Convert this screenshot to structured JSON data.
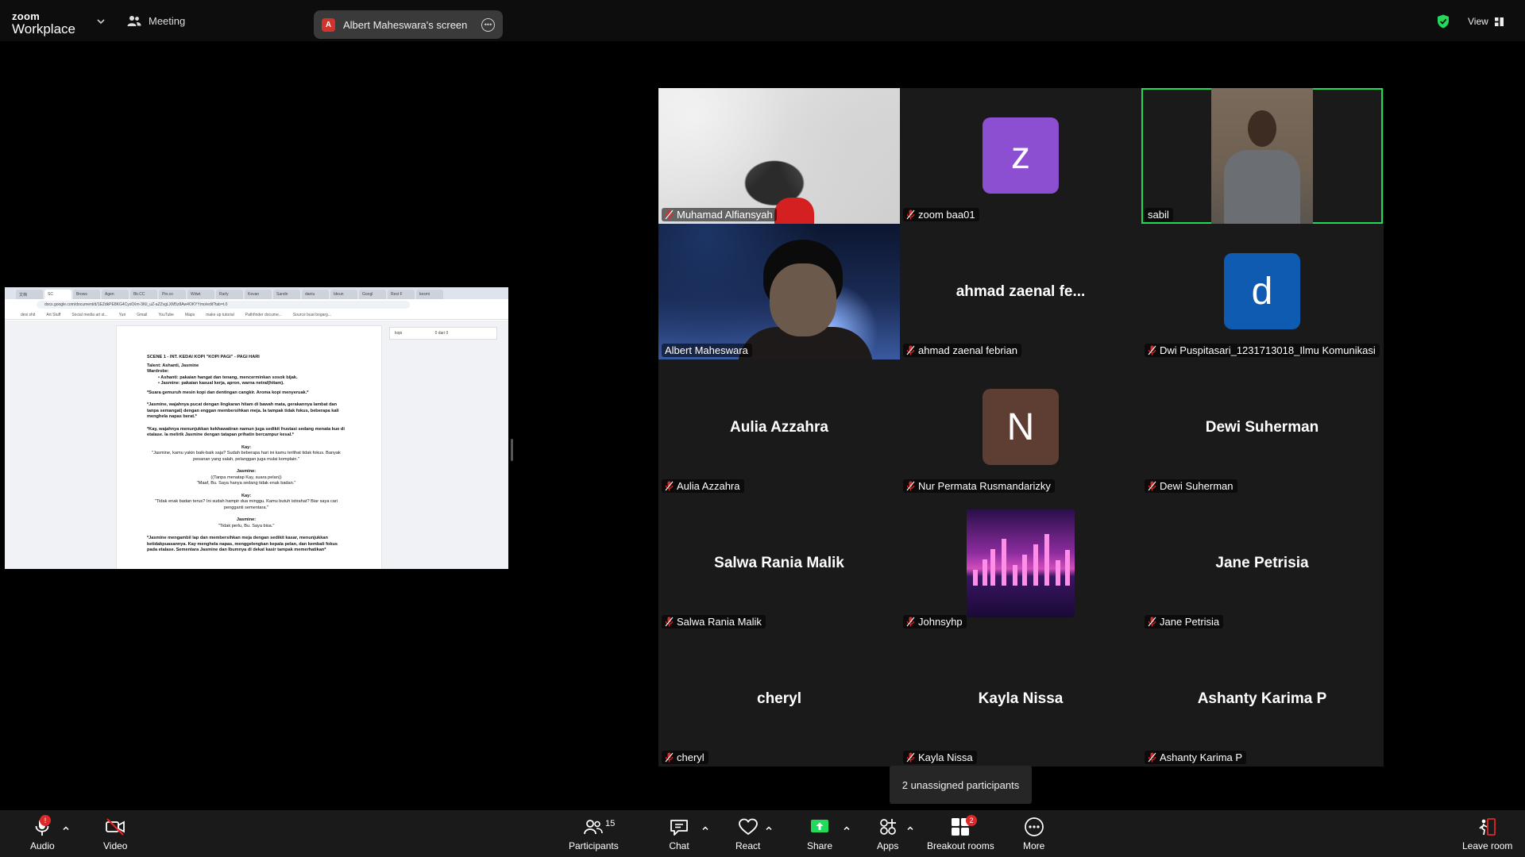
{
  "topbar": {
    "logo_line1": "zoom",
    "logo_line2": "Workplace",
    "meeting_label": "Meeting",
    "sharing_label": "Albert Maheswara's screen",
    "sharing_avatar_letter": "A",
    "view_label": "View",
    "security_color": "#23d959"
  },
  "shared_screen": {
    "tabs": [
      "文档",
      "SC",
      "Brows",
      "Agen",
      "Bk.CC",
      "Pin.co",
      "Wdwt",
      "Rarly",
      "Kevan",
      "Sandn",
      "daniu",
      "Ideun",
      "Googl",
      "Rest F",
      "kesmi"
    ],
    "url": "docs.google.com/document/d/1EZdkPE8KG4Cyx0Xm-3Kil_uZ-aZZvgLXM5z8Aw4OKYYmo/edit?tab=t.0",
    "bookmarks": [
      "desi shit",
      "Art Stuff",
      "Social media art st...",
      "Yuri",
      "Gmail",
      "YouTube",
      "Maps",
      "make up tutorial",
      "Pathfinder docume...",
      "Source buat bogarg..."
    ],
    "find_text": "kopi",
    "find_count": "0 dari 0",
    "doc": {
      "heading": "SCENE 1 - INT. KEDAI KOPI \"KOPI PAGI\" - PAGI HARI",
      "talent": "Talent: Ashanti, Jasmine",
      "wardrobe": "Wardrobe:",
      "w1": "•  Ashanti: pakaian hangat dan tenang, mencerminkan sosok bijak.",
      "w2": "•  Jasmine: pakaian kasual kerja, apron, warna netral(hitam).",
      "p1": "*Suara gemuruh mesin kopi dan dentingan cangkir. Aroma kopi menyeruak.*",
      "p2": "*Jasmine, wajahnya pucat dengan lingkaran hitam di bawah mata, gerakannya lambat dan tanpa semangat) dengan enggan membersihkan meja. Ia tampak tidak fokus, beberapa kali menghela napas berat.*",
      "p3": "*Kay, wajahnya menunjukkan kekhawatiran namun juga sedikit frustasi sedang menata kue di etalase. Ia melirik Jasmine dengan tatapan prihatin bercampur kesal.*",
      "s1": "Kay:",
      "d1": "\"Jasmine, kamu yakin baik-baik saja? Sudah beberapa hari ini kamu terlihat tidak fokus. Banyak pesanan yang salah, pelanggan juga mulai komplain.\"",
      "s2": "Jasmine:",
      "d2a": "((Tanpa menatap Kay, suara pelan))",
      "d2b": "\"Maaf, Bu. Saya hanya sedang tidak enak badan.\"",
      "s3": "Kay:",
      "d3": "\"Tidak enak badan terus? Ini sudah hampir dua minggu. Kamu butuh istirahat? Biar saya cari pengganti sementara.\"",
      "s4": "Jasmine:",
      "d4": "\"Tidak perlu, Bu. Saya bisa.\"",
      "p4": "*Jasmine mengambil lap dan membersihkan meja dengan sedikit kasar, menunjukkan ketidakpuasannya. Kay menghela napas, menggelengkan kepala pelan, dan kembali fokus pada etalase. Sementara Jasmine dan Ibumnya di dekat kasir tampak memerhatikan*"
    }
  },
  "participants": [
    {
      "name": "Muhamad Alfiansyah",
      "muted": true,
      "video": "on",
      "big_label": ""
    },
    {
      "name": "zoom baa01",
      "muted": true,
      "video": "avatar",
      "avatar_letter": "z",
      "avatar_color": "#8c4fd2"
    },
    {
      "name": "sabil",
      "muted": false,
      "video": "on",
      "active_speaker": true
    },
    {
      "name": "Albert Maheswara",
      "muted": false,
      "video": "on"
    },
    {
      "name": "ahmad zaenal febrian",
      "muted": true,
      "video": "name",
      "big_label": "ahmad zaenal fe..."
    },
    {
      "name": "Dwi Puspitasari_1231713018_Ilmu Komunikasi",
      "muted": true,
      "video": "avatar",
      "avatar_letter": "d",
      "avatar_color": "#0f5bb1"
    },
    {
      "name": "Aulia Azzahra",
      "muted": true,
      "video": "name",
      "big_label": "Aulia Azzahra"
    },
    {
      "name": "Nur Permata Rusmandarizky",
      "muted": true,
      "video": "avatar",
      "avatar_letter": "N",
      "avatar_color": "#5e3e32"
    },
    {
      "name": "Dewi Suherman",
      "muted": true,
      "video": "name",
      "big_label": "Dewi Suherman"
    },
    {
      "name": "Salwa Rania Malik",
      "muted": true,
      "video": "name",
      "big_label": "Salwa Rania Malik"
    },
    {
      "name": "Johnsyhp",
      "muted": true,
      "video": "picture"
    },
    {
      "name": "Jane Petrisia",
      "muted": true,
      "video": "name",
      "big_label": "Jane Petrisia"
    },
    {
      "name": "cheryl",
      "muted": true,
      "video": "name",
      "big_label": "cheryl"
    },
    {
      "name": "Kayla Nissa",
      "muted": true,
      "video": "name",
      "big_label": "Kayla Nissa"
    },
    {
      "name": "Ashanty Karima P",
      "muted": true,
      "video": "name",
      "big_label": "Ashanty Karima P"
    }
  ],
  "unassigned_label": "2 unassigned participants",
  "toolbar": {
    "audio": "Audio",
    "video": "Video",
    "participants": "Participants",
    "participants_count": "15",
    "chat": "Chat",
    "react": "React",
    "share": "Share",
    "apps": "Apps",
    "breakout": "Breakout rooms",
    "breakout_badge": "2",
    "more": "More",
    "leave": "Leave room",
    "audio_badge": "!"
  }
}
